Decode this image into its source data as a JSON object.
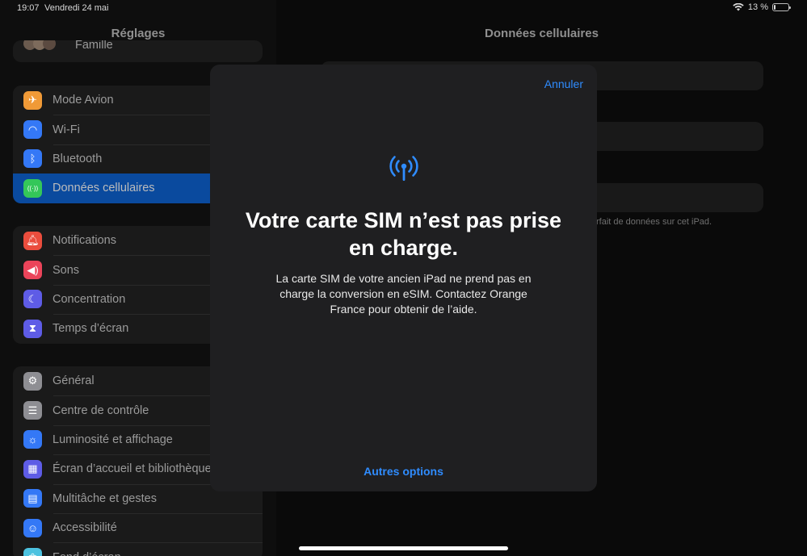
{
  "status_bar": {
    "time": "19:07",
    "date": "Vendredi 24 mai",
    "battery_label": "13 %",
    "battery_level": 0.13
  },
  "sidebar": {
    "title": "Réglages",
    "top_partial_label": "Famille",
    "group1": [
      {
        "label": "Mode Avion",
        "icon": "airplane-icon",
        "color": "#f09a37"
      },
      {
        "label": "Wi-Fi",
        "icon": "wifi-icon",
        "color": "#3478f6"
      },
      {
        "label": "Bluetooth",
        "icon": "bluetooth-icon",
        "color": "#3478f6"
      },
      {
        "label": "Données cellulaires",
        "icon": "cellular-icon",
        "color": "#34c759",
        "selected": true
      }
    ],
    "group2": [
      {
        "label": "Notifications",
        "icon": "notifications-icon",
        "color": "#eb4d3d"
      },
      {
        "label": "Sons",
        "icon": "sounds-icon",
        "color": "#eb445a"
      },
      {
        "label": "Concentration",
        "icon": "moon-icon",
        "color": "#5e5ce6"
      },
      {
        "label": "Temps d’écran",
        "icon": "hourglass-icon",
        "color": "#5e5ce6"
      }
    ],
    "group3": [
      {
        "label": "Général",
        "icon": "gear-icon",
        "color": "#8e8e93"
      },
      {
        "label": "Centre de contrôle",
        "icon": "toggles-icon",
        "color": "#8e8e93"
      },
      {
        "label": "Luminosité et affichage",
        "icon": "sun-icon",
        "color": "#3478f6"
      },
      {
        "label": "Écran d’accueil et bibliothèque",
        "icon": "home-grid-icon",
        "color": "#5e5ce6"
      },
      {
        "label": "Multitâche et gestes",
        "icon": "multitask-icon",
        "color": "#3478f6"
      },
      {
        "label": "Accessibilité",
        "icon": "accessibility-icon",
        "color": "#3478f6"
      },
      {
        "label": "Fond d’écran",
        "icon": "wallpaper-icon",
        "color": "#4cc2e0"
      }
    ]
  },
  "main": {
    "title": "Données cellulaires",
    "footnote": "rfait de données sur cet iPad."
  },
  "modal": {
    "cancel": "Annuler",
    "title": "Votre carte SIM n’est pas prise en charge.",
    "body": "La carte SIM de votre ancien iPad ne prend pas en charge la conversion en eSIM. Contactez Orange France pour obtenir de l’aide.",
    "more_options": "Autres options",
    "accent": "#2f8cff"
  }
}
